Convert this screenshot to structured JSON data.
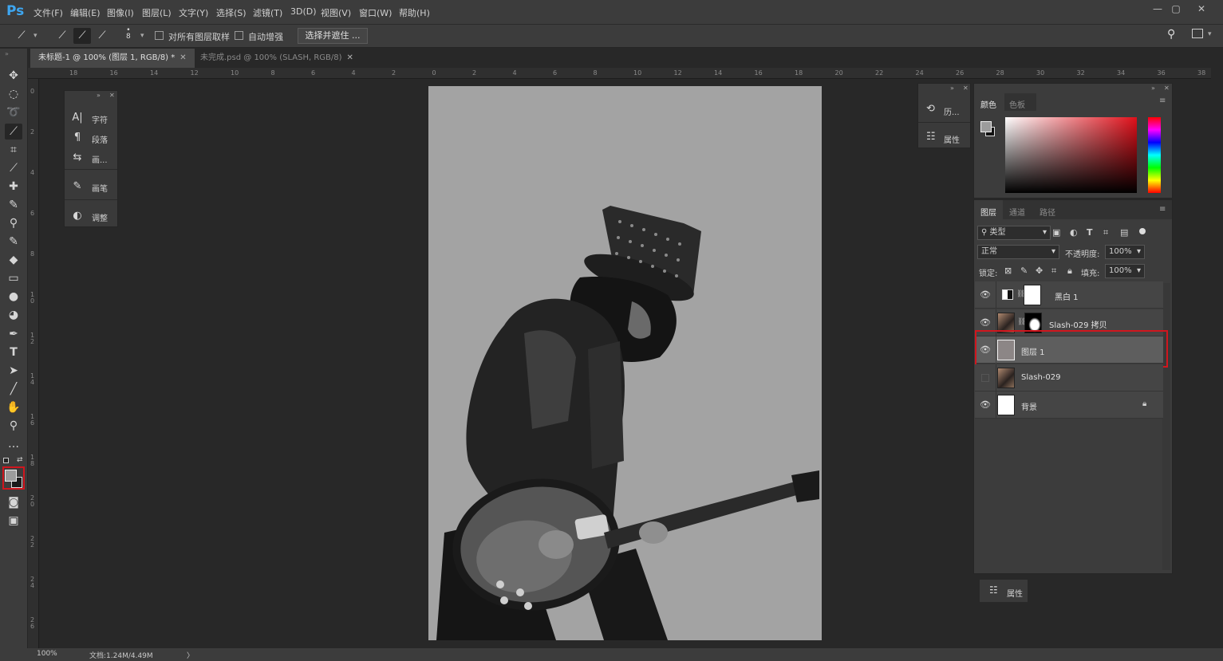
{
  "app": {
    "logo": "Ps",
    "menu": [
      "文件(F)",
      "编辑(E)",
      "图像(I)",
      "图层(L)",
      "文字(Y)",
      "选择(S)",
      "滤镜(T)",
      "3D(D)",
      "视图(V)",
      "窗口(W)",
      "帮助(H)"
    ],
    "window_controls": {
      "minimize": "—",
      "restore": "▢",
      "close": "✕"
    }
  },
  "options_bar": {
    "sample_all_layers": "对所有图层取样",
    "auto_enhance": "自动增强",
    "select_and_mask": "选择并遮住 ...",
    "brush_size": "8"
  },
  "tabs": [
    {
      "label": "未标题-1 @ 100% (图层 1, RGB/8) *",
      "active": true
    },
    {
      "label": "未完成.psd @ 100% (SLASH, RGB/8)",
      "active": false
    }
  ],
  "ruler": {
    "h_ticks": [
      "18",
      "16",
      "14",
      "12",
      "10",
      "8",
      "6",
      "4",
      "2",
      "0",
      "2",
      "4",
      "6",
      "8",
      "10",
      "12",
      "14",
      "16",
      "18",
      "20",
      "22",
      "24",
      "26",
      "28",
      "30",
      "32",
      "34",
      "36",
      "38"
    ],
    "v_ticks": [
      "0",
      "2",
      "4",
      "6",
      "8",
      "1 0",
      "1 2",
      "1 4",
      "1 6",
      "1 8",
      "2 0",
      "2 2",
      "2 4",
      "2 6"
    ]
  },
  "float_panel": {
    "items": [
      {
        "icon": "A|",
        "label": "字符"
      },
      {
        "icon": "¶",
        "label": "段落"
      },
      {
        "icon": "⇆",
        "label": "画..."
      },
      {
        "icon": "✎",
        "label": "画笔"
      },
      {
        "icon": "◐",
        "label": "调整"
      }
    ]
  },
  "mini_dock": {
    "items": [
      {
        "icon": "⟲",
        "label": "历..."
      },
      {
        "icon": "☷",
        "label": "属性"
      }
    ]
  },
  "color_panel": {
    "tabs": [
      "颜色",
      "色板"
    ]
  },
  "layers_panel": {
    "tabs": [
      "图层",
      "通道",
      "路径"
    ],
    "filter_kind": "类型",
    "blend_mode": "正常",
    "opacity_label": "不透明度:",
    "opacity_value": "100%",
    "lock_label": "锁定:",
    "fill_label": "填充:",
    "fill_value": "100%",
    "layers": [
      {
        "name": "黑白 1",
        "visible": true,
        "selected": false,
        "type": "adjustment"
      },
      {
        "name": "Slash-029 拷贝",
        "visible": true,
        "selected": false,
        "type": "masked"
      },
      {
        "name": "图层 1",
        "visible": true,
        "selected": true,
        "type": "fill"
      },
      {
        "name": "Slash-029",
        "visible": false,
        "selected": false,
        "type": "photo"
      },
      {
        "name": "背景",
        "visible": true,
        "selected": false,
        "type": "background",
        "locked": true
      }
    ]
  },
  "props_bottom": {
    "label": "属性"
  },
  "status": {
    "zoom": "100%",
    "doc": "文档:1.24M/4.49M"
  },
  "colors": {
    "canvas_bg": "#a3a3a3",
    "highlight": "#d0161e",
    "ps_blue": "#3ea6f0"
  }
}
